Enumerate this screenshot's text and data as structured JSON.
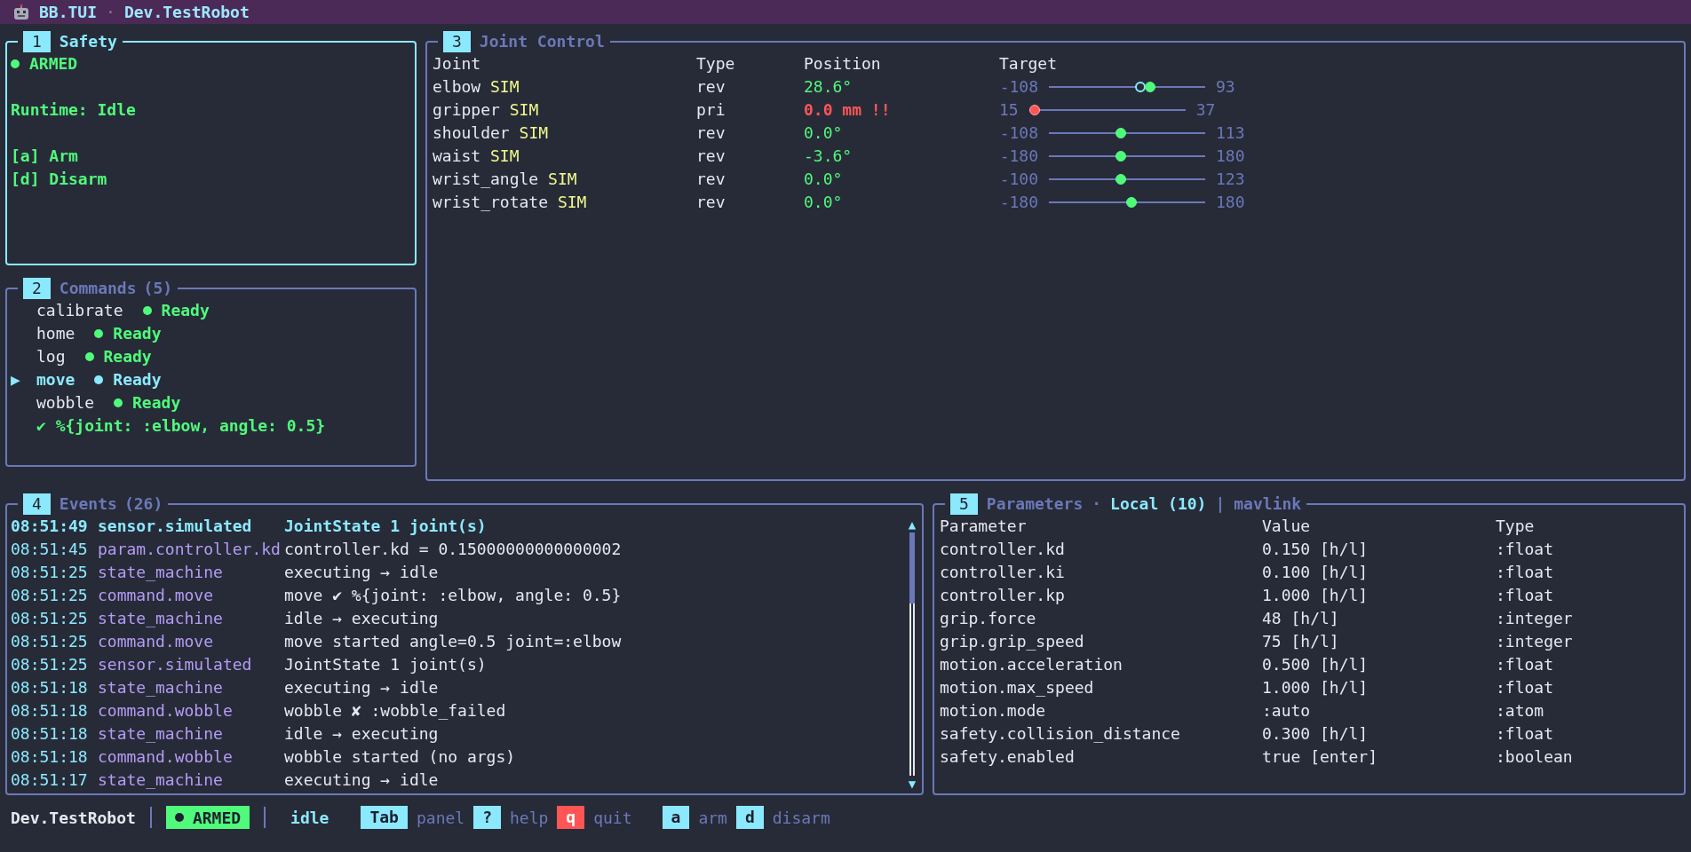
{
  "title_bar": {
    "app": "BB.TUI",
    "separator": "·",
    "robot": "Dev.TestRobot"
  },
  "safety": {
    "number": "1",
    "title": "Safety",
    "focused": true,
    "armed": true,
    "status": "ARMED",
    "runtime": "Runtime: Idle",
    "actions": [
      {
        "text": "[a] Arm"
      },
      {
        "text": "[d] Disarm"
      }
    ]
  },
  "commands": {
    "number": "2",
    "title": "Commands",
    "count": "(5)",
    "focused": false,
    "marker": "▶",
    "items": [
      {
        "name": "calibrate",
        "status": "Ready",
        "selected": false
      },
      {
        "name": "home",
        "status": "Ready",
        "selected": false
      },
      {
        "name": "log",
        "status": "Ready",
        "selected": false
      },
      {
        "name": "move",
        "status": "Ready",
        "selected": true
      },
      {
        "name": "wobble",
        "status": "Ready",
        "selected": false
      }
    ],
    "result": "✔ %{joint: :elbow, angle: 0.5}"
  },
  "joint_control": {
    "number": "3",
    "title": "Joint Control",
    "focused": false,
    "columns": [
      "Joint",
      "Type",
      "Position",
      "Target"
    ],
    "joints": [
      {
        "name": "elbow",
        "tag": "SIM",
        "type": "rev",
        "position": "28.6°",
        "fault": false,
        "min": "-108",
        "max": "93",
        "level": 0.66,
        "target": {
          "level": 0.59
        }
      },
      {
        "name": "gripper",
        "tag": "SIM",
        "type": "pri",
        "position": "0.0 mm !!",
        "fault": true,
        "min": "15",
        "max": "37",
        "level": 0
      },
      {
        "name": "shoulder",
        "tag": "SIM",
        "type": "rev",
        "position": "0.0°",
        "fault": false,
        "min": "-108",
        "max": "113",
        "level": 0.46
      },
      {
        "name": "waist",
        "tag": "SIM",
        "type": "rev",
        "position": "-3.6°",
        "fault": false,
        "min": "-180",
        "max": "180",
        "level": 0.46
      },
      {
        "name": "wrist_angle",
        "tag": "SIM",
        "type": "rev",
        "position": "0.0°",
        "fault": false,
        "min": "-100",
        "max": "123",
        "level": 0.46
      },
      {
        "name": "wrist_rotate",
        "tag": "SIM",
        "type": "rev",
        "position": "0.0°",
        "fault": false,
        "min": "-180",
        "max": "180",
        "level": 0.53
      }
    ]
  },
  "events": {
    "number": "4",
    "title": "Events",
    "count": "(26)",
    "focused": false,
    "rows": [
      {
        "time": "08:51:49",
        "source": "sensor.simulated",
        "message": "JointState 1 joint(s)",
        "selected": true
      },
      {
        "time": "08:51:45",
        "source": "param.controller.kd",
        "message": "controller.kd = 0.15000000000000002",
        "selected": false
      },
      {
        "time": "08:51:25",
        "source": "state_machine",
        "message": "executing → idle",
        "selected": false
      },
      {
        "time": "08:51:25",
        "source": "command.move",
        "message": "move ✔ %{joint: :elbow, angle: 0.5}",
        "selected": false
      },
      {
        "time": "08:51:25",
        "source": "state_machine",
        "message": "idle → executing",
        "selected": false
      },
      {
        "time": "08:51:25",
        "source": "command.move",
        "message": "move started angle=0.5 joint=:elbow",
        "selected": false
      },
      {
        "time": "08:51:25",
        "source": "sensor.simulated",
        "message": "JointState 1 joint(s)",
        "selected": false
      },
      {
        "time": "08:51:18",
        "source": "state_machine",
        "message": "executing → idle",
        "selected": false
      },
      {
        "time": "08:51:18",
        "source": "command.wobble",
        "message": "wobble ✘ :wobble_failed",
        "selected": false
      },
      {
        "time": "08:51:18",
        "source": "state_machine",
        "message": "idle → executing",
        "selected": false
      },
      {
        "time": "08:51:18",
        "source": "command.wobble",
        "message": "wobble started (no args)",
        "selected": false
      },
      {
        "time": "08:51:17",
        "source": "state_machine",
        "message": "executing → idle",
        "selected": false
      }
    ],
    "scroll_up": "▲",
    "scroll_down": "▼"
  },
  "parameters": {
    "number": "5",
    "title": "Parameters",
    "separator": "·",
    "divider": "|",
    "focused": false,
    "sources": [
      {
        "label": "Local (10)",
        "selected": true
      },
      {
        "label": "mavlink",
        "selected": false
      }
    ],
    "columns": [
      "Parameter",
      "Value",
      "Type"
    ],
    "rows": [
      {
        "name": "controller.kd",
        "value": "0.150 [h/l]",
        "type": ":float"
      },
      {
        "name": "controller.ki",
        "value": "0.100 [h/l]",
        "type": ":float"
      },
      {
        "name": "controller.kp",
        "value": "1.000 [h/l]",
        "type": ":float"
      },
      {
        "name": "grip.force",
        "value": "48 [h/l]",
        "type": ":integer"
      },
      {
        "name": "grip.grip_speed",
        "value": "75 [h/l]",
        "type": ":integer"
      },
      {
        "name": "motion.acceleration",
        "value": "0.500 [h/l]",
        "type": ":float"
      },
      {
        "name": "motion.max_speed",
        "value": "1.000 [h/l]",
        "type": ":float"
      },
      {
        "name": "motion.mode",
        "value": ":auto",
        "type": ":atom"
      },
      {
        "name": "safety.collision_distance",
        "value": "0.300 [h/l]",
        "type": ":float"
      },
      {
        "name": "safety.enabled",
        "value": "true [enter]",
        "type": ":boolean"
      }
    ]
  },
  "status_bar": {
    "robot": "Dev.TestRobot",
    "armed": true,
    "badge": "ARMED",
    "state": "idle",
    "key_groups": [
      {
        "keys": [
          {
            "key": "Tab",
            "label": "panel",
            "danger": false
          },
          {
            "key": "?",
            "label": "help",
            "danger": false
          },
          {
            "key": "q",
            "label": "quit",
            "danger": true
          }
        ]
      },
      {
        "keys": [
          {
            "key": "a",
            "label": "arm",
            "danger": false
          },
          {
            "key": "d",
            "label": "disarm",
            "danger": false
          }
        ]
      }
    ]
  }
}
